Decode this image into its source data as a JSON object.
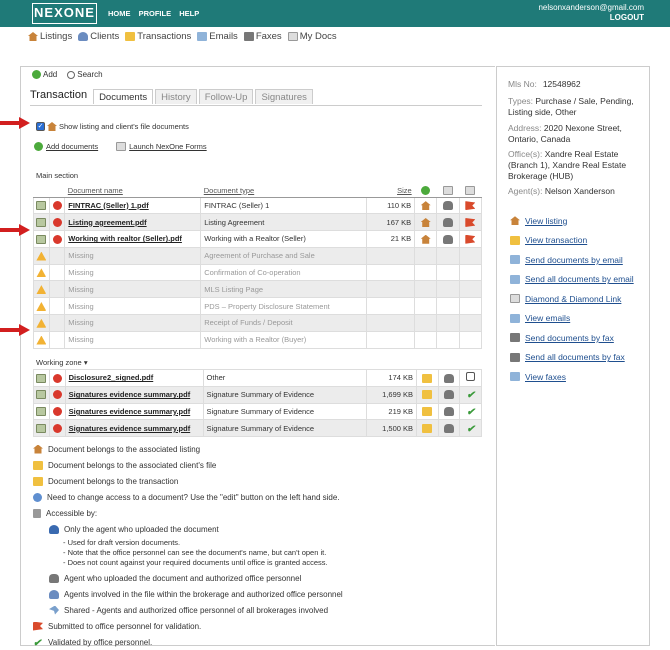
{
  "app": {
    "logo": "NEXONE",
    "nav": [
      "HOME",
      "PROFILE",
      "HELP"
    ],
    "user_email": "nelsonxanderson@gmail.com",
    "logout": "LOGOUT"
  },
  "main_nav": [
    {
      "label": "Listings",
      "icon": "house-icon"
    },
    {
      "label": "Clients",
      "icon": "people-icon"
    },
    {
      "label": "Transactions",
      "icon": "folder-icon"
    },
    {
      "label": "Emails",
      "icon": "mail-icon"
    },
    {
      "label": "Faxes",
      "icon": "fax-icon"
    },
    {
      "label": "My Docs",
      "icon": "doc-icon"
    }
  ],
  "actions": {
    "add": "Add",
    "search": "Search"
  },
  "tabs": {
    "title": "Transaction",
    "items": [
      "Documents",
      "History",
      "Follow-Up",
      "Signatures"
    ],
    "active": "Documents"
  },
  "show_docs_label": "Show listing and client's file documents",
  "links": {
    "add_documents": "Add documents",
    "launch_forms": "Launch NexOne Forms"
  },
  "main_section": {
    "title": "Main section",
    "headers": [
      "Document name",
      "Document type",
      "Size"
    ],
    "rows": [
      {
        "name": "FINTRAC (Seller) 1.pdf",
        "type": "FINTRAC (Seller) 1",
        "size": "110 KB",
        "status": "flag"
      },
      {
        "name": "Listing agreement.pdf",
        "type": "Listing Agreement",
        "size": "167 KB",
        "status": "flag"
      },
      {
        "name": "Working with realtor (Seller).pdf",
        "type": "Working with a Realtor (Seller)",
        "size": "21 KB",
        "status": "flag"
      },
      {
        "name": "Missing",
        "type": "Agreement of Purchase and Sale",
        "size": "",
        "status": "missing"
      },
      {
        "name": "Missing",
        "type": "Confirmation of Co-operation",
        "size": "",
        "status": "missing"
      },
      {
        "name": "Missing",
        "type": "MLS Listing Page",
        "size": "",
        "status": "missing"
      },
      {
        "name": "Missing",
        "type": "PDS – Property Disclosure Statement",
        "size": "",
        "status": "missing"
      },
      {
        "name": "Missing",
        "type": "Receipt of Funds / Deposit",
        "size": "",
        "status": "missing"
      },
      {
        "name": "Missing",
        "type": "Working with a Realtor (Buyer)",
        "size": "",
        "status": "missing"
      }
    ]
  },
  "working_zone": {
    "title": "Working zone",
    "rows": [
      {
        "name": "Disclosure2_signed.pdf",
        "type": "Other",
        "size": "174 KB",
        "status": "checkbox"
      },
      {
        "name": "Signatures evidence summary.pdf",
        "type": "Signature Summary of Evidence",
        "size": "1,699 KB",
        "status": "check"
      },
      {
        "name": "Signatures evidence summary.pdf",
        "type": "Signature Summary of Evidence",
        "size": "219 KB",
        "status": "check"
      },
      {
        "name": "Signatures evidence summary.pdf",
        "type": "Signature Summary of Evidence",
        "size": "1,500 KB",
        "status": "check"
      }
    ]
  },
  "legend": {
    "listing": "Document belongs to the associated listing",
    "client": "Document belongs to the associated client's file",
    "transaction": "Document belongs to the transaction",
    "access": "Need to change access to a document? Use the \"edit\" button on the left hand side.",
    "accessible_by": "Accessible by:",
    "only_agent": "Only the agent who uploaded the document",
    "note1": "- Used for draft version documents.",
    "note2": "- Note that the office personnel can see the document's name, but can't open it.",
    "note3": "- Does not count against your required documents until office is granted access.",
    "agent_office": "Agent who uploaded the document and authorized office personnel",
    "agents_brokerage": "Agents involved in the file within the brokerage and authorized office personnel",
    "shared": "Shared - Agents and authorized office personnel of all brokerages involved",
    "submitted": "Submitted to office personnel for validation.",
    "validated": "Validated by office personnel."
  },
  "side": {
    "mls_label": "Mls No:",
    "mls_value": "12548962",
    "types_label": "Types:",
    "types_value": "Purchase / Sale, Pending, Listing side, Other",
    "address_label": "Address:",
    "address_value": "2020 Nexone Street, Ontario, Canada",
    "office_label": "Office(s):",
    "office_value": "Xandre Real Estate (Branch 1), Xandre Real Estate Brokerage (HUB)",
    "agent_label": "Agent(s):",
    "agent_value": "Nelson Xanderson",
    "links": [
      "View listing",
      "View transaction",
      "Send documents by email",
      "Send all documents by email",
      "Diamond & Diamond Link",
      "View emails",
      "Send documents by fax",
      "Send all documents by fax",
      "View faxes"
    ]
  }
}
